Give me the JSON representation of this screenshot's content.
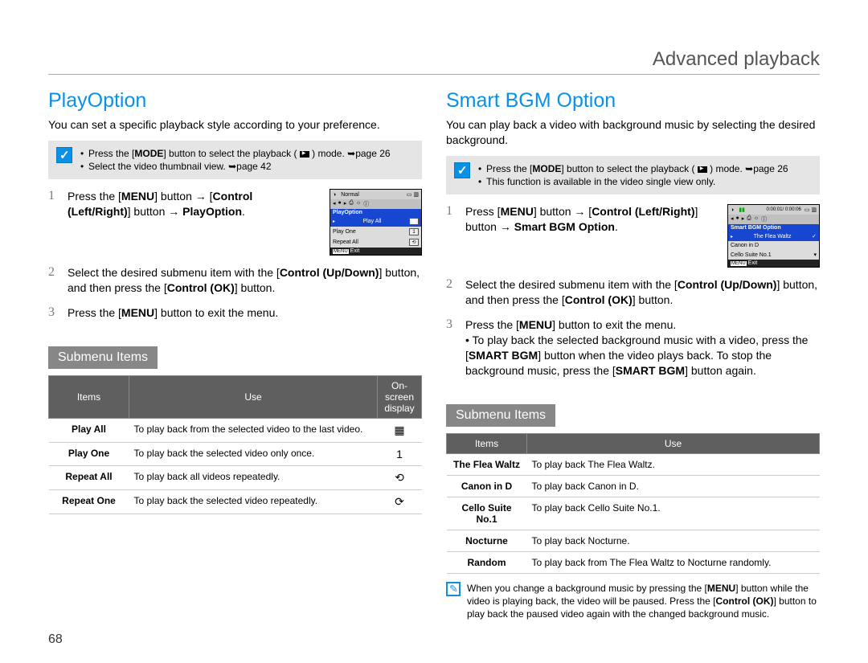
{
  "header": {
    "title": "Advanced playback"
  },
  "page_number": "68",
  "left": {
    "heading": "PlayOption",
    "subtitle": "You can set a specific playback style according to your preference.",
    "note": {
      "items": [
        "Press the [MODE] button to select the playback ( ▶ ) mode. ➥page 26",
        "Select the video thumbnail view. ➥page 42"
      ]
    },
    "steps": {
      "s1": "Press the [MENU] button → [Control (Left/Right)] button → PlayOption.",
      "s2": "Select the desired submenu item with the [Control (Up/Down)] button, and then press the [Control (OK)] button.",
      "s3": "Press the [MENU] button to exit the menu."
    },
    "screenshot": {
      "top": "Normal",
      "header": "PlayOption",
      "rows": [
        "Play All",
        "Play One",
        "Repeat All"
      ],
      "selected": 0,
      "footer_label": "MENU",
      "footer_text": "Exit"
    },
    "submenu_label": "Submenu Items",
    "table": {
      "headers": [
        "Items",
        "Use",
        "On-screen display"
      ],
      "rows": [
        {
          "name": "Play All",
          "use": "To play back from the selected video to the last video.",
          "icon": "▦"
        },
        {
          "name": "Play One",
          "use": "To play back the selected video only once.",
          "icon": "1"
        },
        {
          "name": "Repeat All",
          "use": "To play back all videos repeatedly.",
          "icon": "⟲"
        },
        {
          "name": "Repeat One",
          "use": "To play back the selected video repeatedly.",
          "icon": "⟳"
        }
      ]
    }
  },
  "right": {
    "heading": "Smart BGM Option",
    "subtitle": "You can play back a video with background music by selecting the desired background.",
    "note": {
      "items": [
        "Press the [MODE] button to select the playback ( ▶ ) mode. ➥page 26",
        "This function is available in the video single view only."
      ]
    },
    "steps": {
      "s1": "Press [MENU] button → [Control (Left/Right)] button → Smart BGM Option.",
      "s2": "Select the desired submenu item with the [Control (Up/Down)] button, and then press the [Control (OK)] button.",
      "s3": "Press the [MENU] button to exit the menu."
    },
    "extra_bullet": "To play back the selected background music with a video, press the [SMART BGM] button when the video plays back. To stop the background music, press the [SMART BGM] button again.",
    "screenshot": {
      "top_time": "0:00:01/ 0:00:06",
      "header": "Smart BGM Option",
      "rows": [
        "The Flea Waltz",
        "Canon in D",
        "Cello Suite No.1"
      ],
      "selected": 0,
      "footer_label": "MENU",
      "footer_text": "Exit"
    },
    "submenu_label": "Submenu Items",
    "table": {
      "headers": [
        "Items",
        "Use"
      ],
      "rows": [
        {
          "name": "The Flea Waltz",
          "use": "To play back The Flea Waltz."
        },
        {
          "name": "Canon in D",
          "use": "To play back Canon in D."
        },
        {
          "name": "Cello Suite No.1",
          "use": "To play back Cello Suite No.1."
        },
        {
          "name": "Nocturne",
          "use": "To play back Nocturne."
        },
        {
          "name": "Random",
          "use": "To play back from The Flea Waltz to Nocturne randomly."
        }
      ]
    },
    "footnote": "When you change a background music by pressing the [MENU] button while the video is playing back, the video will be paused. Press the [Control (OK)] button to play back the paused video again with the changed background music."
  }
}
